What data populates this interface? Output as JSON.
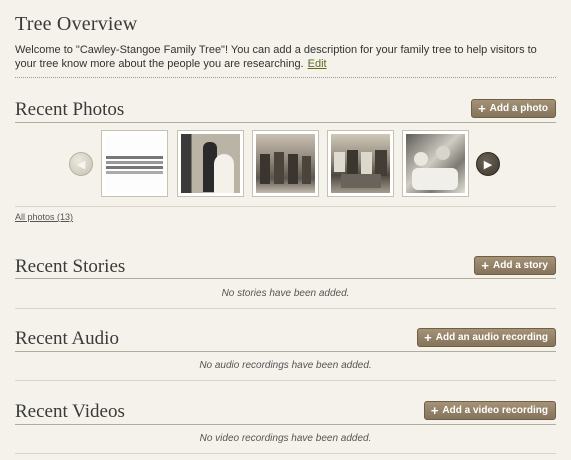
{
  "header": {
    "title": "Tree Overview",
    "welcome_text": "Welcome to \"Cawley-Stangoe Family Tree\"! You can add a description for your family tree to help visitors to your tree know more about the people you are researching.",
    "edit_link": "Edit"
  },
  "photos": {
    "title": "Recent Photos",
    "add_button": "Add a photo",
    "thumbnails": [
      {
        "kind": "document"
      },
      {
        "kind": "wedding couple"
      },
      {
        "kind": "group photo"
      },
      {
        "kind": "group photo"
      },
      {
        "kind": "group photo"
      }
    ],
    "all_link": "All photos (13)"
  },
  "stories": {
    "title": "Recent Stories",
    "add_button": "Add a story",
    "empty_message": "No stories have been added."
  },
  "audio": {
    "title": "Recent Audio",
    "add_button": "Add an audio recording",
    "empty_message": "No audio recordings have been added."
  },
  "videos": {
    "title": "Recent Videos",
    "add_button": "Add a video recording",
    "empty_message": "No video recordings have been added."
  },
  "icons": {
    "plus": "plus-icon",
    "prev": "chevron-left-icon",
    "next": "chevron-right-icon"
  },
  "colors": {
    "background": "#f4f2ea",
    "button": "#8d7b61",
    "link": "#5b6b1e",
    "rule": "#b3ad9c"
  }
}
